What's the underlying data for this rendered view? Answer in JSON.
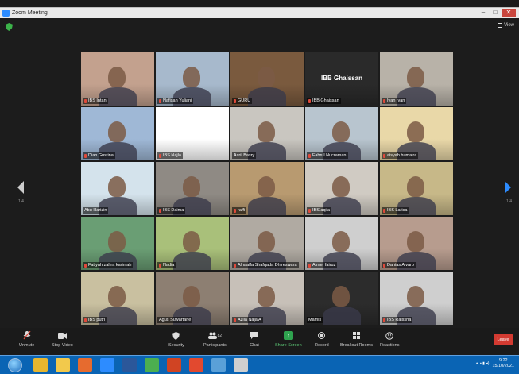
{
  "window": {
    "title": "Zoom Meeting"
  },
  "view_label": "View",
  "page_indicator": {
    "left": "1/4",
    "right": "1/4"
  },
  "tiles": [
    {
      "name": "IBS Intan",
      "muted": true,
      "bg": "#c3a18e"
    },
    {
      "name": "Nafisah Yuliani",
      "muted": true,
      "bg": "#a7b9cc"
    },
    {
      "name": "GURU",
      "muted": true,
      "bg": "#7a5a3e"
    },
    {
      "name": "IBB Ghaissan",
      "muted": true,
      "bg": "#2a2a2a",
      "show_center_name": true
    },
    {
      "name": "Ivan Ivan",
      "muted": true,
      "bg": "#b8b2a8"
    },
    {
      "name": "Dian Gustina",
      "muted": true,
      "bg": "#9fb8d6"
    },
    {
      "name": "IBS Najla",
      "muted": true,
      "bg": "#ffffff"
    },
    {
      "name": "Asril Basry",
      "muted": false,
      "bg": "#c9c6c0"
    },
    {
      "name": "Fahrul Nurzaman",
      "muted": true,
      "bg": "#b8c5cf"
    },
    {
      "name": "aisyah humaira",
      "muted": true,
      "bg": "#e9d8a8"
    },
    {
      "name": "Abu Harizin",
      "muted": false,
      "bg": "#d4e3ec"
    },
    {
      "name": "IBS Daima",
      "muted": true,
      "bg": "#8f8a84"
    },
    {
      "name": "raffi",
      "muted": true,
      "bg": "#b89a70"
    },
    {
      "name": "IBS aqila",
      "muted": true,
      "bg": "#d0cbc3"
    },
    {
      "name": "IBS Larisa",
      "muted": true,
      "bg": "#c7b888"
    },
    {
      "name": "Fatiyah zahra karimah",
      "muted": true,
      "bg": "#6a9e74"
    },
    {
      "name": "Nadia",
      "muted": true,
      "bg": "#a9c07a"
    },
    {
      "name": "Alnaaffa Shafqada Dhireswara",
      "muted": true,
      "bg": "#b0aaa2"
    },
    {
      "name": "Almer fairuz",
      "muted": true,
      "bg": "#cfcfcf"
    },
    {
      "name": "Danias Alvaro",
      "muted": true,
      "bg": "#b79c8e"
    },
    {
      "name": "IBS putri",
      "muted": true,
      "bg": "#c9c0a0"
    },
    {
      "name": "Agus Suwartane",
      "muted": false,
      "bg": "#8d7f72"
    },
    {
      "name": "Azlia Naja A",
      "muted": true,
      "bg": "#c7c0b8"
    },
    {
      "name": "Mamis",
      "muted": false,
      "bg": "#2c2c2c"
    },
    {
      "name": "IBS Raissha",
      "muted": true,
      "bg": "#cfcfcf"
    }
  ],
  "toolbar": {
    "unmute": "Unmute",
    "stop_video": "Stop Video",
    "security": "Security",
    "participants": "Participants",
    "participants_count": "82",
    "chat": "Chat",
    "share_screen": "Share Screen",
    "record": "Record",
    "breakout_rooms": "Breakout Rooms",
    "reactions": "Reactions",
    "leave": "Leave"
  },
  "taskbar": {
    "time": "9:22",
    "date": "15/10/2021",
    "apps": [
      {
        "icon": "chrome-icon",
        "color": "#e7b62f"
      },
      {
        "icon": "file-explorer-icon",
        "color": "#f2c94c"
      },
      {
        "icon": "firefox-icon",
        "color": "#e66b2f"
      },
      {
        "icon": "zoom-icon",
        "color": "#2d8cff"
      },
      {
        "icon": "word-icon",
        "color": "#2b579a"
      },
      {
        "icon": "chrome-icon-2",
        "color": "#4caf50"
      },
      {
        "icon": "powerpoint-icon",
        "color": "#d04423"
      },
      {
        "icon": "pdf-icon",
        "color": "#e2492f"
      },
      {
        "icon": "photos-icon",
        "color": "#5aa0d8"
      },
      {
        "icon": "paint-icon",
        "color": "#cfcfcf"
      }
    ]
  }
}
